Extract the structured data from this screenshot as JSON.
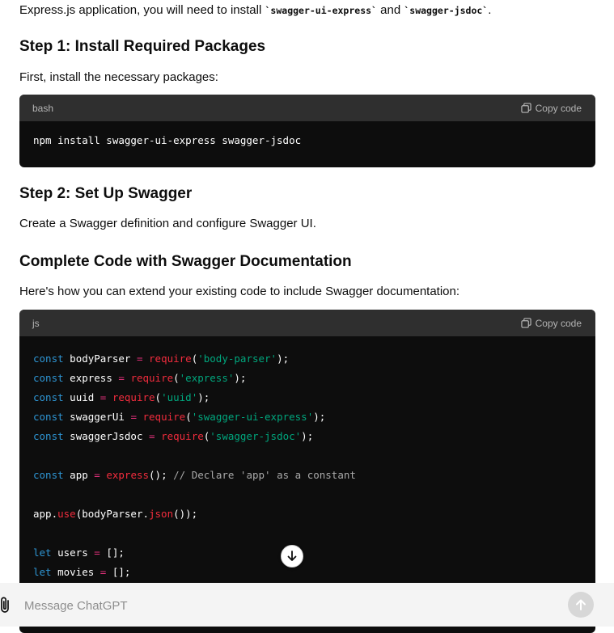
{
  "intro": {
    "prefix": "Express.js application, you will need to install ",
    "pkg1": "`swagger-ui-express`",
    "mid": " and ",
    "pkg2": "`swagger-jsdoc`",
    "suffix": "."
  },
  "step1": {
    "heading": "Step 1: Install Required Packages",
    "text": "First, install the necessary packages:"
  },
  "bash_block": {
    "lang": "bash",
    "copy_label": "Copy code",
    "code": "npm install swagger-ui-express swagger-jsdoc"
  },
  "step2": {
    "heading": "Step 2: Set Up Swagger",
    "text": "Create a Swagger definition and configure Swagger UI."
  },
  "complete": {
    "heading": "Complete Code with Swagger Documentation",
    "text": "Here's how you can extend your existing code to include Swagger documentation:"
  },
  "js_block": {
    "lang": "js",
    "copy_label": "Copy code",
    "lines": [
      [
        [
          "k",
          "const"
        ],
        [
          "p",
          " bodyParser "
        ],
        [
          "o",
          "="
        ],
        [
          "p",
          " "
        ],
        [
          "f",
          "require"
        ],
        [
          "p",
          "("
        ],
        [
          "s",
          "'body-parser'"
        ],
        [
          "p",
          ");"
        ]
      ],
      [
        [
          "k",
          "const"
        ],
        [
          "p",
          " express "
        ],
        [
          "o",
          "="
        ],
        [
          "p",
          " "
        ],
        [
          "f",
          "require"
        ],
        [
          "p",
          "("
        ],
        [
          "s",
          "'express'"
        ],
        [
          "p",
          ");"
        ]
      ],
      [
        [
          "k",
          "const"
        ],
        [
          "p",
          " uuid "
        ],
        [
          "o",
          "="
        ],
        [
          "p",
          " "
        ],
        [
          "f",
          "require"
        ],
        [
          "p",
          "("
        ],
        [
          "s",
          "'uuid'"
        ],
        [
          "p",
          ");"
        ]
      ],
      [
        [
          "k",
          "const"
        ],
        [
          "p",
          " swaggerUi "
        ],
        [
          "o",
          "="
        ],
        [
          "p",
          " "
        ],
        [
          "f",
          "require"
        ],
        [
          "p",
          "("
        ],
        [
          "s",
          "'swagger-ui-express'"
        ],
        [
          "p",
          ");"
        ]
      ],
      [
        [
          "k",
          "const"
        ],
        [
          "p",
          " swaggerJsdoc "
        ],
        [
          "o",
          "="
        ],
        [
          "p",
          " "
        ],
        [
          "f",
          "require"
        ],
        [
          "p",
          "("
        ],
        [
          "s",
          "'swagger-jsdoc'"
        ],
        [
          "p",
          ");"
        ]
      ],
      [],
      [
        [
          "k",
          "const"
        ],
        [
          "p",
          " app "
        ],
        [
          "o",
          "="
        ],
        [
          "p",
          " "
        ],
        [
          "f",
          "express"
        ],
        [
          "p",
          "(); "
        ],
        [
          "c",
          "// Declare 'app' as a constant"
        ]
      ],
      [],
      [
        [
          "p",
          "app."
        ],
        [
          "f",
          "use"
        ],
        [
          "p",
          "(bodyParser."
        ],
        [
          "f",
          "json"
        ],
        [
          "p",
          "());"
        ]
      ],
      [],
      [
        [
          "k",
          "let"
        ],
        [
          "p",
          " users "
        ],
        [
          "o",
          "="
        ],
        [
          "p",
          " [];"
        ]
      ],
      [
        [
          "k",
          "let"
        ],
        [
          "p",
          " movies "
        ],
        [
          "o",
          "="
        ],
        [
          "p",
          " [];"
        ]
      ]
    ]
  },
  "composer": {
    "placeholder": "Message ChatGPT"
  },
  "colors": {
    "code_bg": "#0d0d0d",
    "code_header_bg": "#2f2f2f",
    "keyword": "#2e95d3",
    "function": "#f22c3d",
    "string": "#00a67d",
    "comment": "#a9a9a9"
  },
  "icons": {
    "copy": "copy-icon",
    "scroll_down": "arrow-down-icon",
    "attach": "paperclip-icon",
    "send": "arrow-up-icon"
  }
}
